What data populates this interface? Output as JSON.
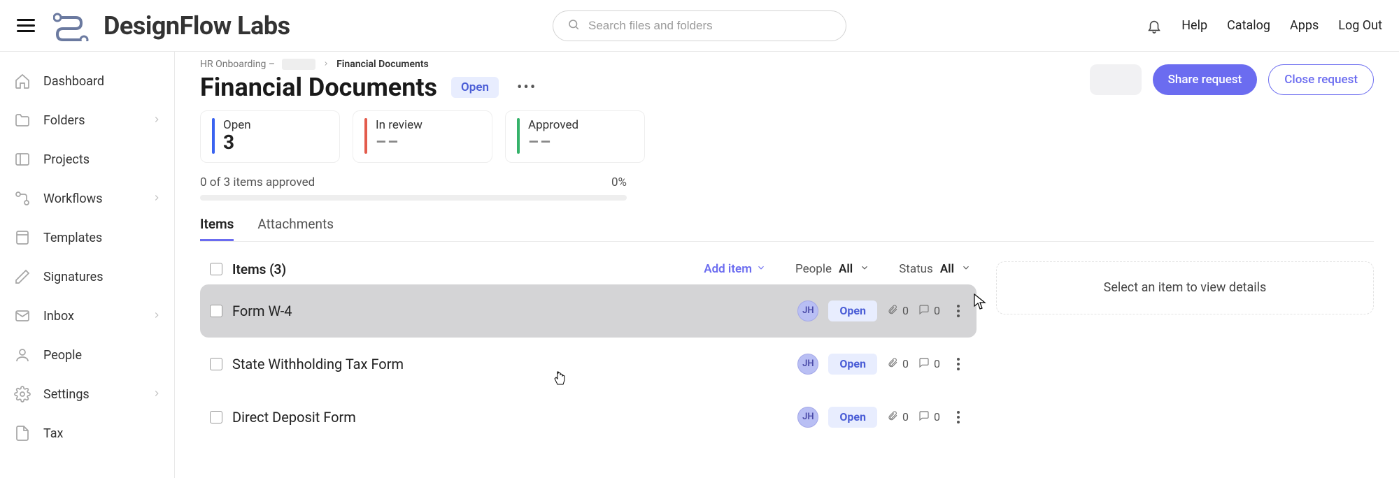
{
  "brand": "DesignFlow Labs",
  "search": {
    "placeholder": "Search files and folders"
  },
  "topnav": {
    "help": "Help",
    "catalog": "Catalog",
    "apps": "Apps",
    "logout": "Log Out"
  },
  "sidebar": {
    "items": [
      {
        "label": "Dashboard",
        "icon": "home",
        "chevron": false
      },
      {
        "label": "Folders",
        "icon": "folder",
        "chevron": true
      },
      {
        "label": "Projects",
        "icon": "projects",
        "chevron": false
      },
      {
        "label": "Workflows",
        "icon": "workflow",
        "chevron": true
      },
      {
        "label": "Templates",
        "icon": "template",
        "chevron": false
      },
      {
        "label": "Signatures",
        "icon": "pen",
        "chevron": false
      },
      {
        "label": "Inbox",
        "icon": "mail",
        "chevron": true
      },
      {
        "label": "People",
        "icon": "person",
        "chevron": false
      },
      {
        "label": "Settings",
        "icon": "gear",
        "chevron": true
      },
      {
        "label": "Tax",
        "icon": "doc",
        "chevron": false
      }
    ]
  },
  "breadcrumb": {
    "root": "HR Onboarding – ",
    "current": "Financial Documents"
  },
  "page": {
    "title": "Financial Documents",
    "status": "Open",
    "share": "Share request",
    "close": "Close request"
  },
  "stats": {
    "open": {
      "label": "Open",
      "value": "3"
    },
    "review": {
      "label": "In review",
      "value": "––"
    },
    "approved": {
      "label": "Approved",
      "value": "––"
    }
  },
  "progress": {
    "text": "0 of 3 items approved",
    "percent": "0%"
  },
  "tabs": {
    "items": "Items",
    "attachments": "Attachments"
  },
  "list": {
    "heading": "Items (3)",
    "add": "Add item",
    "filter_people_label": "People",
    "filter_people_value": "All",
    "filter_status_label": "Status",
    "filter_status_value": "All",
    "rows": [
      {
        "name": "Form W-4",
        "initials": "JH",
        "status": "Open",
        "attachments": "0",
        "comments": "0"
      },
      {
        "name": "State Withholding Tax Form",
        "initials": "JH",
        "status": "Open",
        "attachments": "0",
        "comments": "0"
      },
      {
        "name": "Direct Deposit Form",
        "initials": "JH",
        "status": "Open",
        "attachments": "0",
        "comments": "0"
      }
    ]
  },
  "details_empty": "Select an item to view details"
}
